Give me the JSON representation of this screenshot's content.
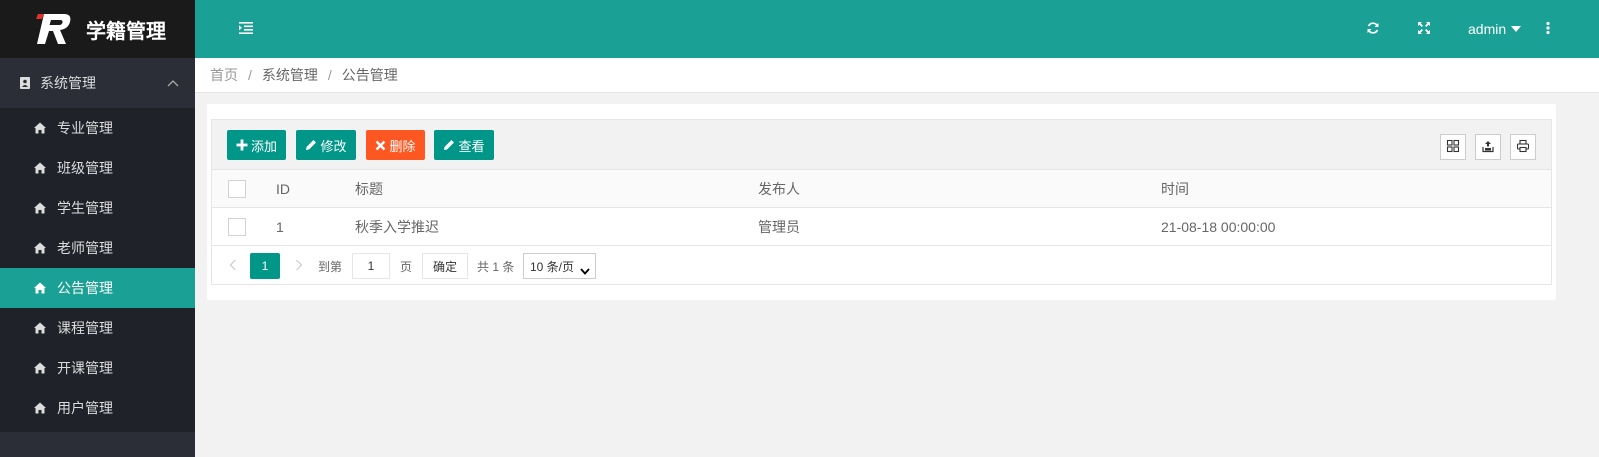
{
  "app": {
    "logo_text": "学籍管理"
  },
  "sidebar": {
    "group_label": "系统管理",
    "items": [
      {
        "label": "专业管理",
        "active": false
      },
      {
        "label": "班级管理",
        "active": false
      },
      {
        "label": "学生管理",
        "active": false
      },
      {
        "label": "老师管理",
        "active": false
      },
      {
        "label": "公告管理",
        "active": true
      },
      {
        "label": "课程管理",
        "active": false
      },
      {
        "label": "开课管理",
        "active": false
      },
      {
        "label": "用户管理",
        "active": false
      }
    ]
  },
  "header": {
    "username": "admin"
  },
  "breadcrumb": {
    "home": "首页",
    "parent": "系统管理",
    "current": "公告管理"
  },
  "toolbar": {
    "add": "添加",
    "edit": "修改",
    "delete": "删除",
    "view": "查看"
  },
  "table": {
    "columns": {
      "id": "ID",
      "title": "标题",
      "publisher": "发布人",
      "time": "时间"
    },
    "rows": [
      {
        "id": "1",
        "title": "秋季入学推迟",
        "publisher": "管理员",
        "time": "21-08-18 00:00:00"
      }
    ]
  },
  "pagination": {
    "current_page": "1",
    "goto_label": "到第",
    "goto_value": "1",
    "page_unit": "页",
    "confirm": "确定",
    "total": "共 1 条",
    "page_size": "10 条/页"
  },
  "colors": {
    "accent": "#1aa094",
    "primary_button": "#009688",
    "danger_button": "#ff5722",
    "sidebar_bg": "#20222a"
  }
}
